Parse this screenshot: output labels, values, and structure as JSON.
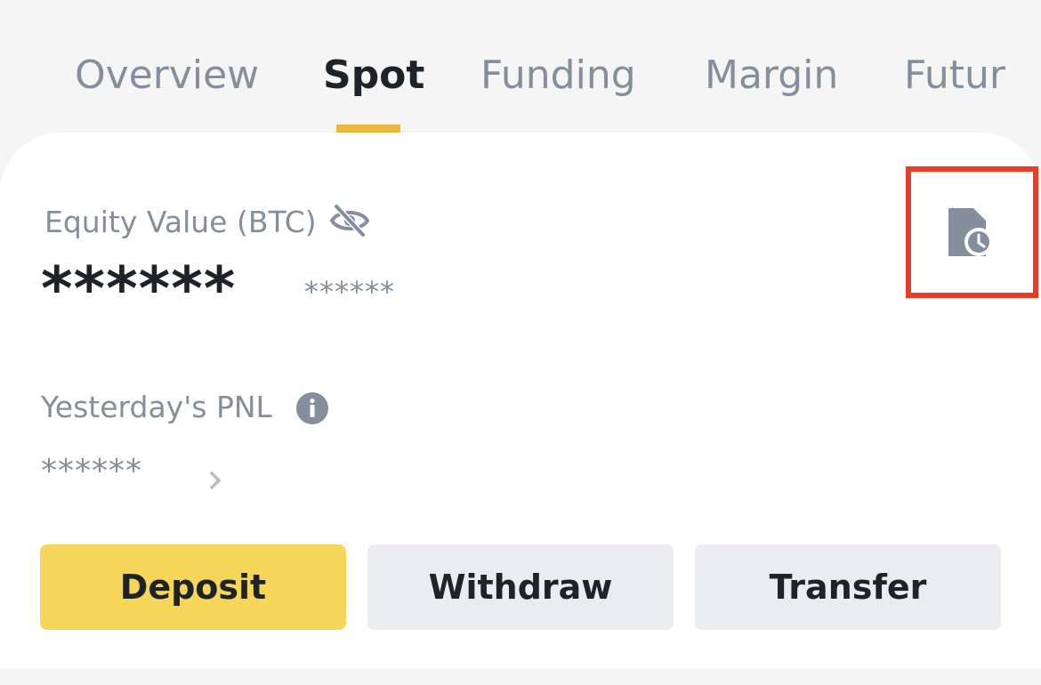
{
  "tabs": [
    {
      "label": "Overview",
      "active": false
    },
    {
      "label": "Spot",
      "active": true
    },
    {
      "label": "Funding",
      "active": false
    },
    {
      "label": "Margin",
      "active": false
    },
    {
      "label": "Futur",
      "active": false
    }
  ],
  "equity": {
    "label": "Equity Value (BTC)",
    "value": "******",
    "sub_value": "******",
    "visibility_icon": "eye-slash-icon"
  },
  "history": {
    "icon": "document-history-icon",
    "highlight_color": "#E54025"
  },
  "pnl": {
    "label": "Yesterday's PNL",
    "info_icon": "info-icon",
    "value": "******",
    "chevron_icon": "chevron-right-icon"
  },
  "actions": {
    "deposit": "Deposit",
    "withdraw": "Withdraw",
    "transfer": "Transfer"
  },
  "colors": {
    "accent": "#E8B93A",
    "primary_button": "#F6D659",
    "secondary_button": "#EAECEF",
    "text_primary": "#1E2329",
    "text_secondary": "#848E9C",
    "background": "#F5F5F5"
  }
}
